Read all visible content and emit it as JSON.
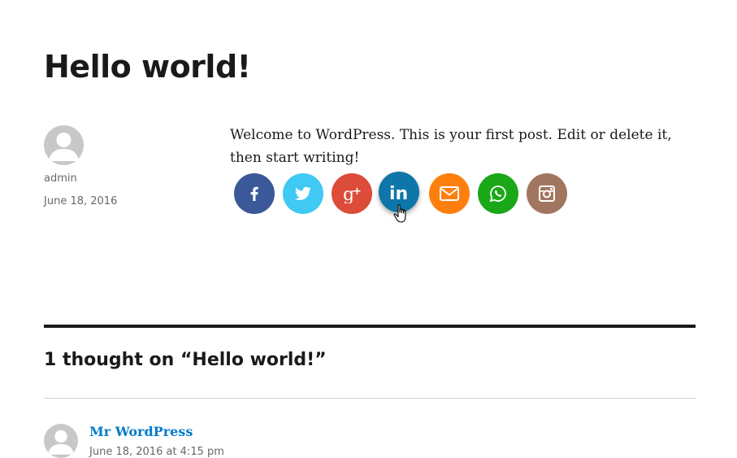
{
  "post": {
    "title": "Hello world!",
    "author": "admin",
    "date": "June 18, 2016",
    "content": "Welcome to WordPress. This is your first post. Edit or delete it, then start writing!"
  },
  "share_buttons": [
    {
      "name": "facebook",
      "icon": "facebook-icon",
      "color": "#3b5998"
    },
    {
      "name": "twitter",
      "icon": "twitter-icon",
      "color": "#3fc9f3"
    },
    {
      "name": "google-plus",
      "icon": "google-plus-icon",
      "color": "#dd4b39"
    },
    {
      "name": "linkedin",
      "icon": "linkedin-icon",
      "color": "#0e76a8",
      "hovered": true
    },
    {
      "name": "email",
      "icon": "email-icon",
      "color": "#ff7f0e"
    },
    {
      "name": "whatsapp",
      "icon": "whatsapp-icon",
      "color": "#1ba818"
    },
    {
      "name": "instagram",
      "icon": "instagram-icon",
      "color": "#a17660"
    }
  ],
  "comments": {
    "title": "1 thought on “Hello world!”",
    "items": [
      {
        "author": "Mr WordPress",
        "date": "June 18, 2016 at 4:15 pm"
      }
    ]
  },
  "colors": {
    "link": "#007acc",
    "meta_text": "#686868",
    "text": "#1a1a1a"
  }
}
